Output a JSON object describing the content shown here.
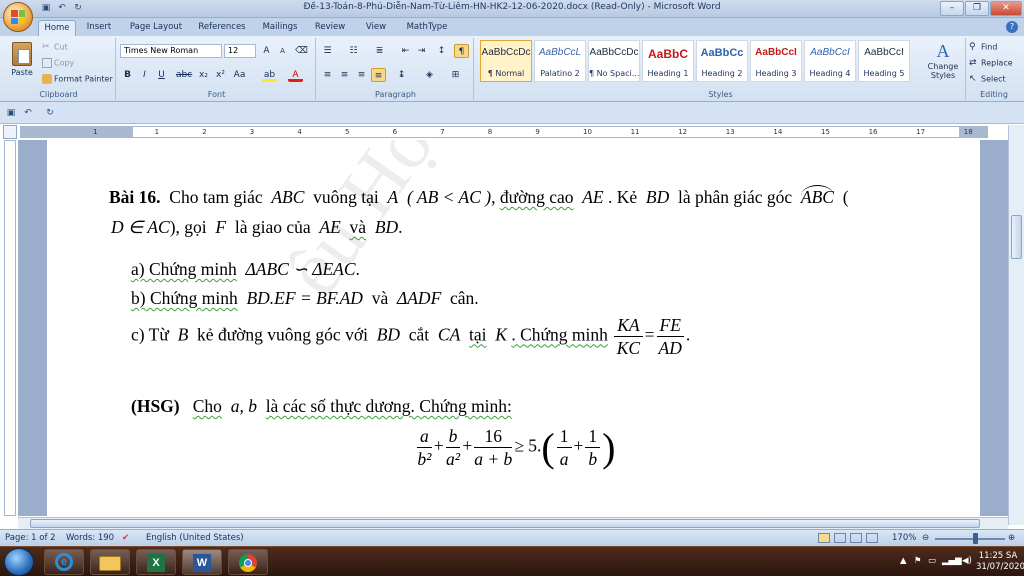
{
  "window": {
    "title": "Đề-13-Toán-8-Phú-Diễn-Nam-Từ-Liêm-HN-HK2-12-06-2020.docx (Read-Only) - Microsoft Word"
  },
  "tabs": [
    "Home",
    "Insert",
    "Page Layout",
    "References",
    "Mailings",
    "Review",
    "View",
    "MathType"
  ],
  "clipboard": {
    "paste": "Paste",
    "cut": "Cut",
    "copy": "Copy",
    "format_painter": "Format Painter",
    "label": "Clipboard"
  },
  "font": {
    "name": "Times New Roman",
    "size": "12",
    "label": "Font"
  },
  "paragraph": {
    "label": "Paragraph"
  },
  "styles": {
    "label": "Styles",
    "items": [
      {
        "preview": "AaBbCcDc",
        "name": "¶ Normal"
      },
      {
        "preview": "AaBbCcL",
        "name": "Palatino 2"
      },
      {
        "preview": "AaBbCcDc",
        "name": "¶ No Spaci..."
      },
      {
        "preview": "AaBbC",
        "name": "Heading 1"
      },
      {
        "preview": "AaBbCc",
        "name": "Heading 2"
      },
      {
        "preview": "AaBbCcI",
        "name": "Heading 3"
      },
      {
        "preview": "AaBbCcI",
        "name": "Heading 4"
      },
      {
        "preview": "AaBbCcI",
        "name": "Heading 5"
      }
    ],
    "change_styles": "Change Styles"
  },
  "editing": {
    "find": "Find",
    "replace": "Replace",
    "select": "Select",
    "label": "Editing"
  },
  "ruler_numbers": [
    "1",
    "1",
    "2",
    "3",
    "4",
    "5",
    "6",
    "7",
    "8",
    "9",
    "10",
    "11",
    "12",
    "13",
    "14",
    "15",
    "16",
    "17",
    "18",
    "19"
  ],
  "document": {
    "l1_bold": "Bài 16.",
    "l1_a": "Cho tam giác",
    "l1_abc": "ABC",
    "l1_b": "vuông tại",
    "l1_A": "A",
    "l1_cond": "( AB < AC ),",
    "l1_c": "đường cao",
    "l1_ae": "AE",
    "l1_d": ". Kẻ",
    "l1_bd": "BD",
    "l1_e": "là phân giác góc",
    "l1_angle": "ABC",
    "l1_f": "(",
    "l2_a": "D ∈ AC",
    "l2_b": "), gọi",
    "l2_F": "F",
    "l2_c": "là giao của",
    "l2_ae": "AE",
    "l2_va": "và",
    "l2_bd": "BD",
    "l2_d": ".",
    "a_text": "a) Chứng minh",
    "a_math": "ΔABC ∽ ΔEAC",
    "a_end": ".",
    "b_text": "b) Chứng minh",
    "b_math": "BD.EF = BF.AD",
    "b_and": "và",
    "b_tri": "ΔADF",
    "b_end": "cân.",
    "c_text": "c) Từ",
    "c_B": "B",
    "c_mid": "kẻ đường vuông góc với",
    "c_BD": "BD",
    "c_cat": "cắt",
    "c_CA": "CA",
    "c_tai": "tại",
    "c_K": "K",
    "c_end": ". Chứng minh",
    "c_f1n": "KA",
    "c_f1d": "KC",
    "c_eq": "=",
    "c_f2n": "FE",
    "c_f2d": "AD",
    "c_dot": ".",
    "hsg_label": "(HSG)",
    "hsg_text": "Cho",
    "hsg_ab": "a, b",
    "hsg_rest": "là các số thực dương. Chứng minh:",
    "ineq": {
      "f1n": "a",
      "f1d": "b²",
      "plus1": "+",
      "f2n": "b",
      "f2d": "a²",
      "plus2": "+",
      "f3n": "16",
      "f3d": "a + b",
      "ge": "≥ 5.",
      "lp": "(",
      "f4n": "1",
      "f4d": "a",
      "plus3": "+",
      "f5n": "1",
      "f5d": "b",
      "rp": ")"
    },
    "watermark": "ều Học & THCS"
  },
  "status": {
    "page": "Page: 1 of 2",
    "words": "Words: 190",
    "language": "English (United States)",
    "zoom": "170%"
  },
  "tray": {
    "time": "11:25 SA",
    "date": "31/07/2020"
  },
  "colors": {
    "ribbon": "#d3e1f2",
    "accent": "#3c6ec0",
    "taskbar": "#2b160d"
  }
}
